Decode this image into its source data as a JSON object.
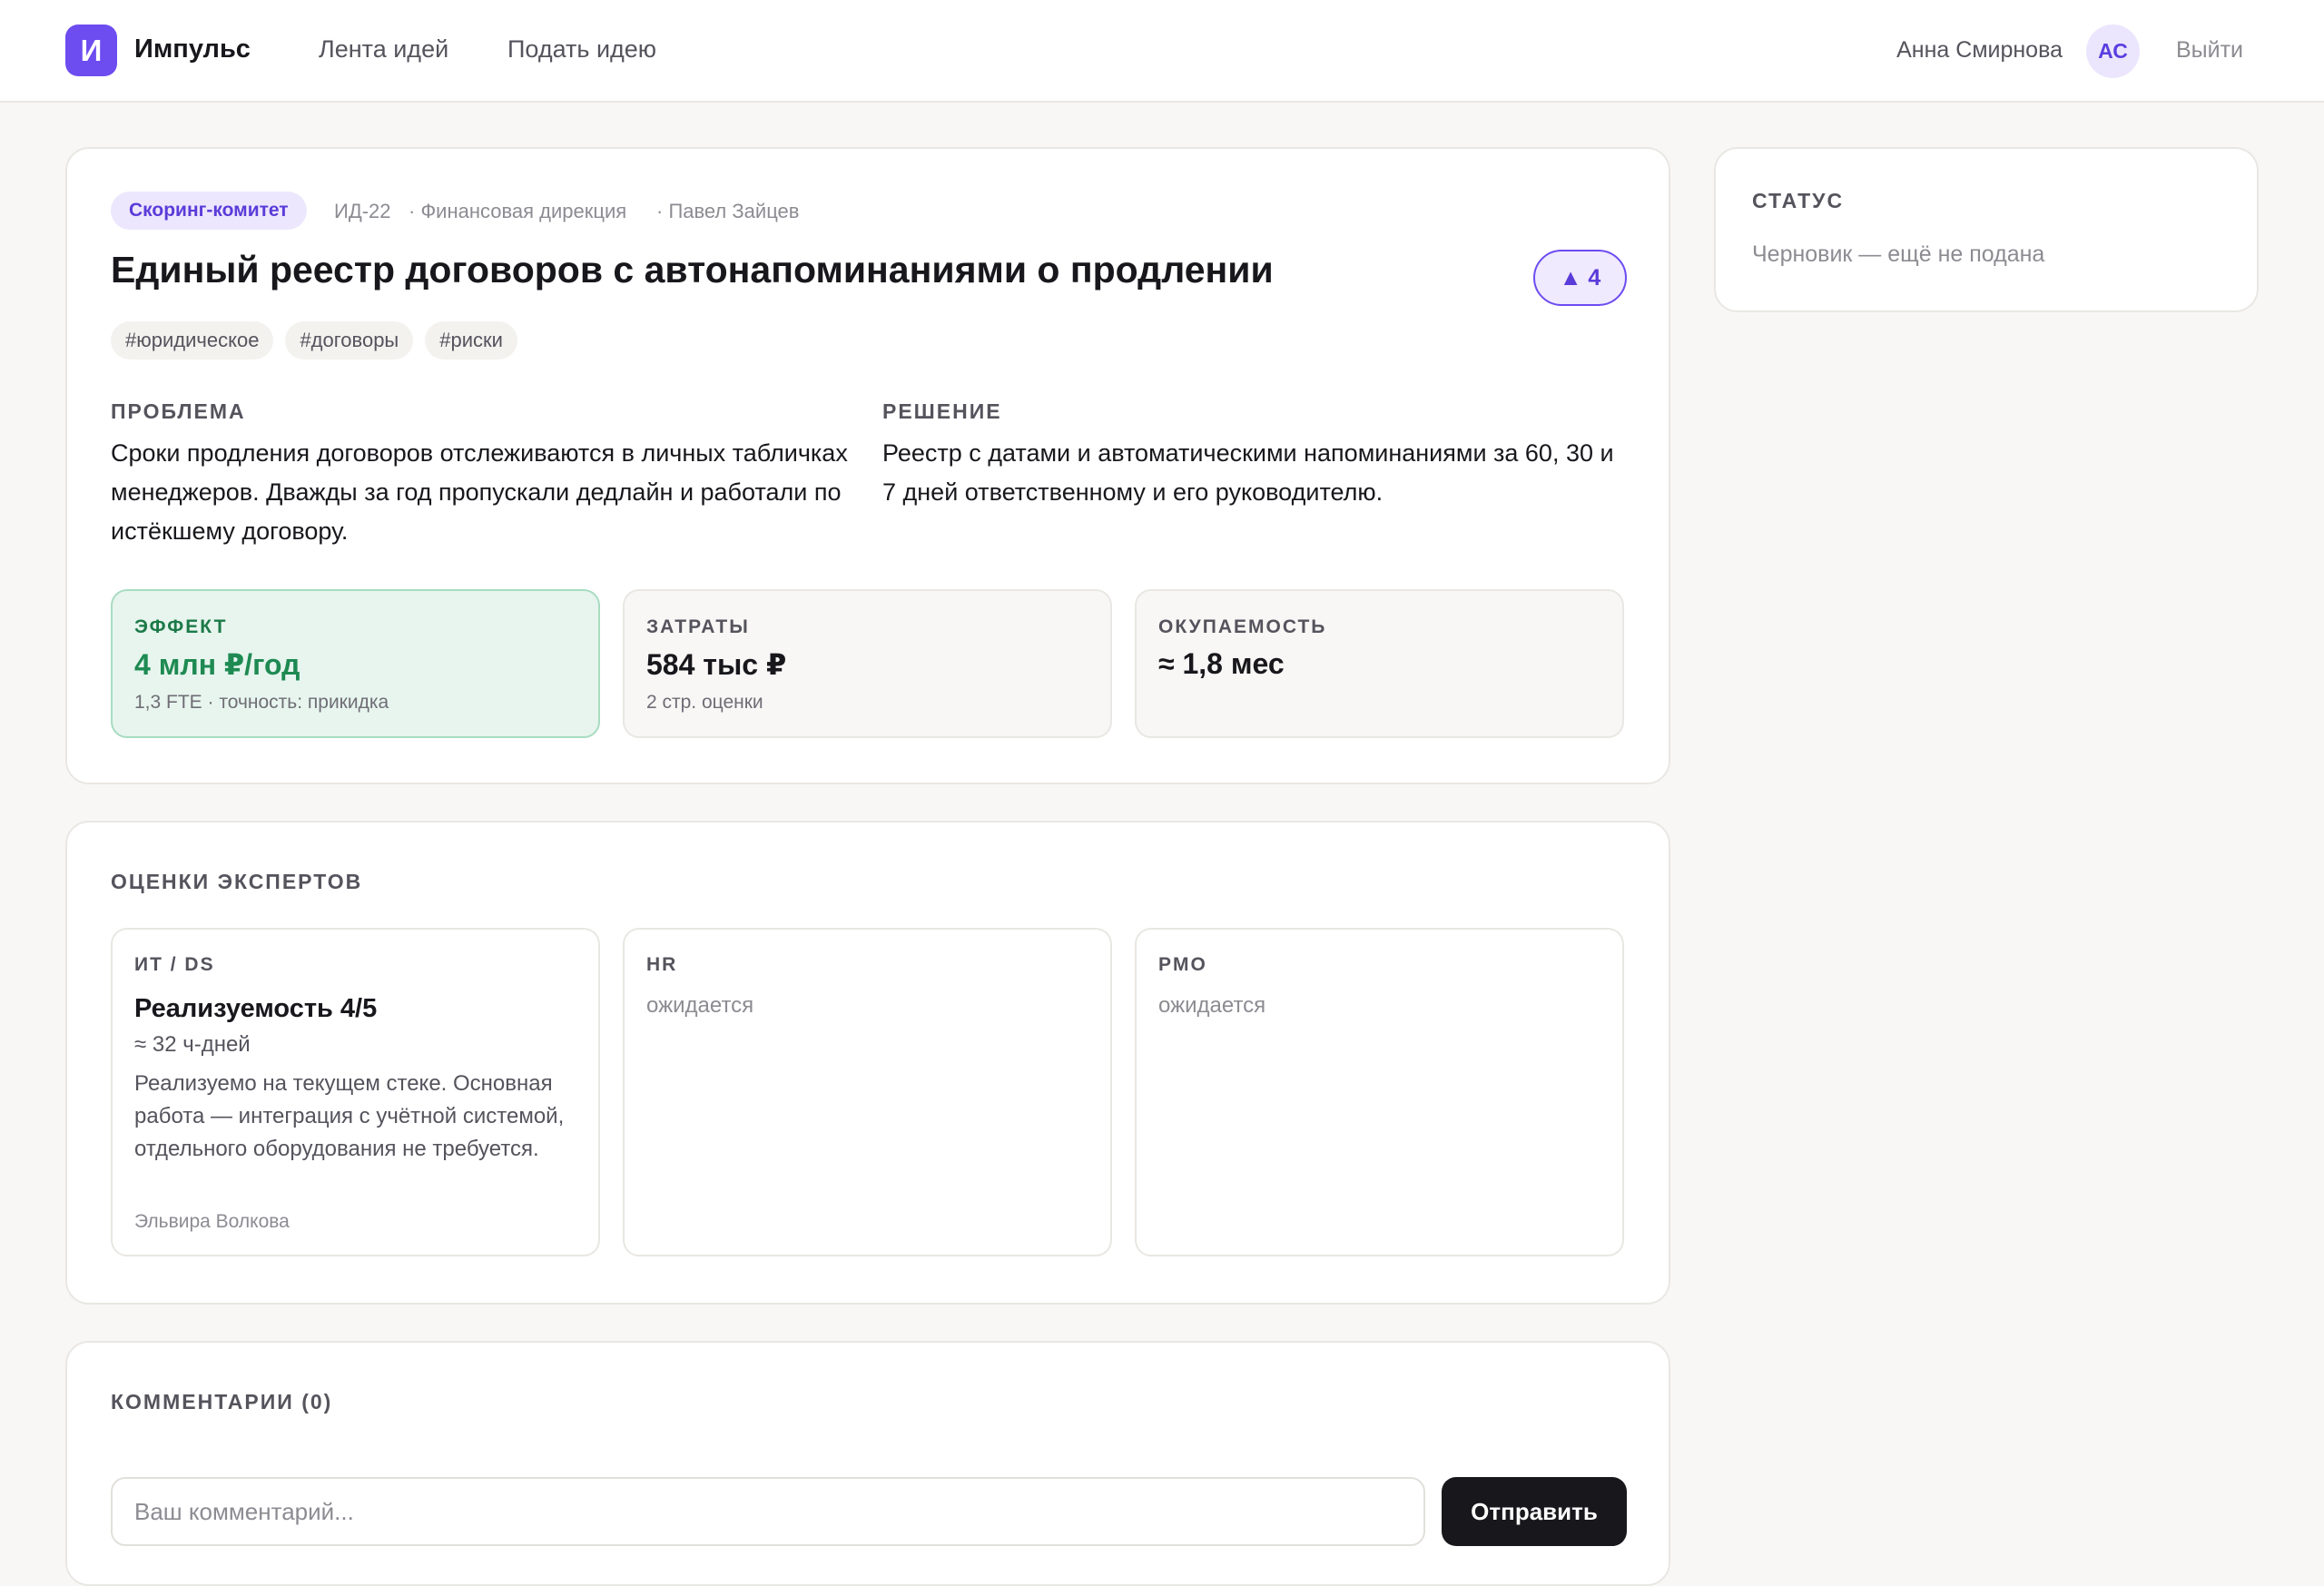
{
  "header": {
    "logo_letter": "И",
    "brand": "Импульс",
    "nav": [
      "Лента идей",
      "Подать идею"
    ],
    "user_name": "Анна Смирнова",
    "avatar_initials": "АС",
    "logout": "Выйти"
  },
  "idea": {
    "committee": "Скоринг-комитет",
    "id": "ИД-22",
    "department": "· Финансовая дирекция",
    "author": "· Павел Зайцев",
    "title": "Единый реестр договоров с автонапоминаниями о продлении",
    "votes": "▲ 4",
    "tags": [
      "#юридическое",
      "#договоры",
      "#риски"
    ],
    "problem_label": "ПРОБЛЕМА",
    "problem_text": "Сроки продления договоров отслеживаются в личных табличках менеджеров. Дважды за год пропускали дедлайн и работали по истёкшему договору.",
    "solution_label": "РЕШЕНИЕ",
    "solution_text": "Реестр с датами и автоматическими напоминаниями за 60, 30 и 7 дней ответственному и его руководителю.",
    "metrics": [
      {
        "label": "ЭФФЕКТ",
        "value": "4 млн ₽/год",
        "sub": "1,3 FTE · точность: прикидка"
      },
      {
        "label": "ЗАТРАТЫ",
        "value": "584 тыс ₽",
        "sub": "2 стр. оценки"
      },
      {
        "label": "ОКУПАЕМОСТЬ",
        "value": "≈ 1,8 мес",
        "sub": ""
      }
    ]
  },
  "experts": {
    "title": "ОЦЕНКИ ЭКСПЕРТОВ",
    "items": [
      {
        "role": "ИТ / DS",
        "score": "Реализуемость 4/5",
        "effort": "≈ 32 ч-дней",
        "text": "Реализуемо на текущем стеке. Основная работа — интеграция с учётной системой, отдельного оборудования не требуется.",
        "author": "Эльвира Волкова"
      },
      {
        "role": "HR",
        "pending": "ожидается"
      },
      {
        "role": "PMO",
        "pending": "ожидается"
      }
    ]
  },
  "comments": {
    "title": "КОММЕНТАРИИ (0)",
    "placeholder": "Ваш комментарий...",
    "value": "",
    "send": "Отправить"
  },
  "status": {
    "label": "СТАТУС",
    "text": "Черновик — ещё не подана"
  },
  "colors": {
    "accent": "#6d4cf0",
    "effect_green": "#1e8a52",
    "dark_button": "#18171c"
  }
}
